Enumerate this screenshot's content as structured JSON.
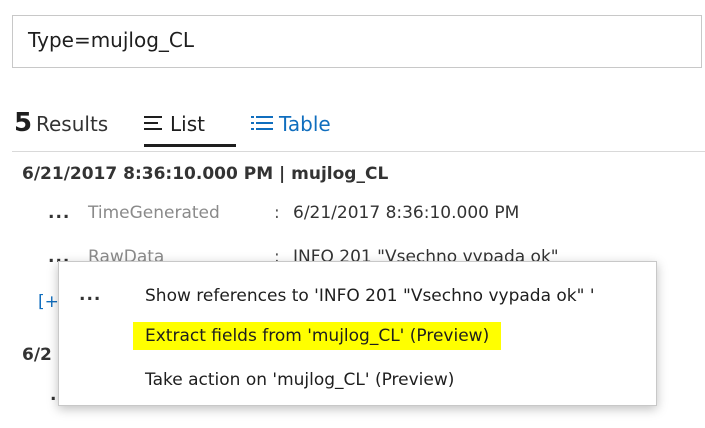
{
  "query": {
    "text": "Type=mujlog_CL"
  },
  "results": {
    "count": "5",
    "label": "Results",
    "views": [
      {
        "label": "List",
        "icon": "list-icon",
        "active": true
      },
      {
        "label": "Table",
        "icon": "table-icon",
        "active": false
      }
    ]
  },
  "record": {
    "header": "6/21/2017 8:36:10.000 PM | mujlog_CL",
    "fields": [
      {
        "more": "...",
        "name": "TimeGenerated",
        "colon": ":",
        "value": "6/21/2017 8:36:10.000 PM"
      },
      {
        "more": "...",
        "name": "RawData",
        "colon": ":",
        "value": "INFO 201 \"Vsechno vypada ok\""
      }
    ],
    "expand": "[+"
  },
  "second_record": {
    "header_fragment": "6/2",
    "more": "."
  },
  "context_menu": {
    "more": "...",
    "items": [
      {
        "label": "Show references to 'INFO 201 \"Vsechno vypada ok\" '",
        "highlighted": false
      },
      {
        "label": "Extract fields from 'mujlog_CL' (Preview)",
        "highlighted": true
      },
      {
        "label": "Take action on 'mujlog_CL' (Preview)",
        "highlighted": false
      }
    ]
  },
  "colors": {
    "accent": "#106ebe",
    "highlight": "#ffff00",
    "field_name": "#8a8a8a"
  }
}
